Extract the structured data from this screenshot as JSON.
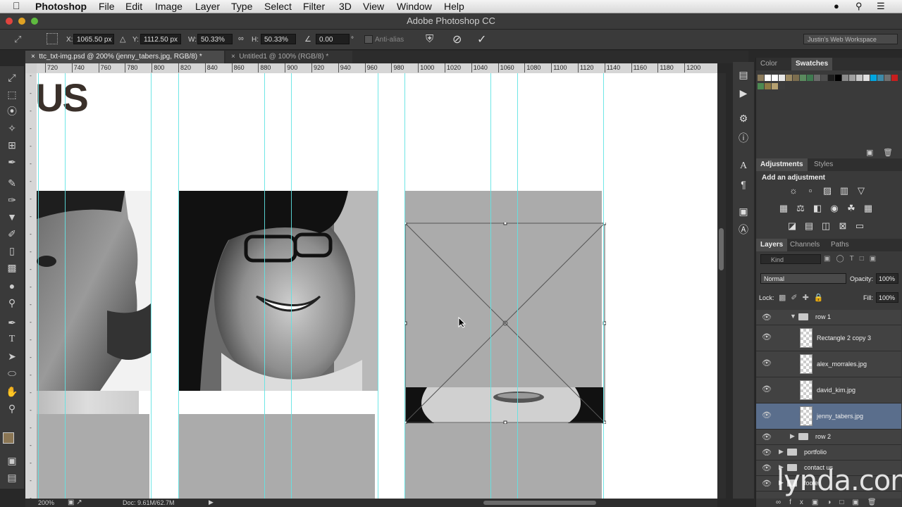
{
  "menubar": {
    "app_name": "Photoshop",
    "items": [
      "File",
      "Edit",
      "Image",
      "Layer",
      "Type",
      "Select",
      "Filter",
      "3D",
      "View",
      "Window",
      "Help"
    ]
  },
  "window": {
    "title": "Adobe Photoshop CC"
  },
  "options": {
    "x_label": "X:",
    "x_value": "1065.50 px",
    "y_label": "Y:",
    "y_value": "1112.50 px",
    "w_label": "W:",
    "w_value": "50.33%",
    "h_label": "H:",
    "h_value": "50.33%",
    "angle_value": "0.00",
    "angle_unit": "°",
    "antialias_label": "Anti-alias",
    "workspace": "Justin's Web Workspace"
  },
  "tabs": [
    {
      "label": "ttc_txt-img.psd @ 200% (jenny_tabers.jpg, RGB/8) *"
    },
    {
      "label": "Untitled1 @ 100% (RGB/8) *"
    }
  ],
  "ruler": {
    "h_ticks": [
      "720",
      "740",
      "760",
      "780",
      "800",
      "820",
      "840",
      "860",
      "880",
      "900",
      "920",
      "940",
      "960",
      "980",
      "1000",
      "1020",
      "1040",
      "1060",
      "1080",
      "1100",
      "1120",
      "1140",
      "1160",
      "1180",
      "1200"
    ]
  },
  "canvas": {
    "heading_fragment": "US"
  },
  "status": {
    "zoom": "200%",
    "doc": "Doc: 9.61M/62.7M"
  },
  "panels": {
    "color_tab": "Color",
    "swatches_tab": "Swatches",
    "adjustments_tab": "Adjustments",
    "styles_tab": "Styles",
    "add_adjustment": "Add an adjustment",
    "layers_tab": "Layers",
    "channels_tab": "Channels",
    "paths_tab": "Paths",
    "kind_filter": "Kind",
    "blend_mode": "Normal",
    "opacity_label": "Opacity:",
    "opacity_value": "100%",
    "lock_label": "Lock:",
    "fill_label": "Fill:",
    "fill_value": "100%",
    "swatch_colors": [
      "#8c7c5c",
      "#ffffff",
      "#ffffff",
      "#e8e8e8",
      "#9c8a63",
      "#7d6e4f",
      "#5a8a5e",
      "#3f7a50",
      "#6b6b6b",
      "#4e4e4e",
      "#1c1c1c",
      "#000000",
      "#8a8a8a",
      "#a0a0a0",
      "#c8c8c8",
      "#e0e0e0",
      "#00a6e0",
      "#3f8aa8",
      "#707070",
      "#c81e1e",
      "#4d8a52",
      "#8e7a44",
      "#b5a070",
      "#3c3c3c"
    ]
  },
  "layers": {
    "row1": "row 1",
    "items": [
      "Rectangle 2 copy 3",
      "alex_morrales.jpg",
      "david_kim.jpg",
      "jenny_tabers.jpg"
    ],
    "row2": "row 2",
    "portfolio": "portfolio",
    "contact": "contact us",
    "footer": "footer"
  },
  "watermark": "lynda.com"
}
